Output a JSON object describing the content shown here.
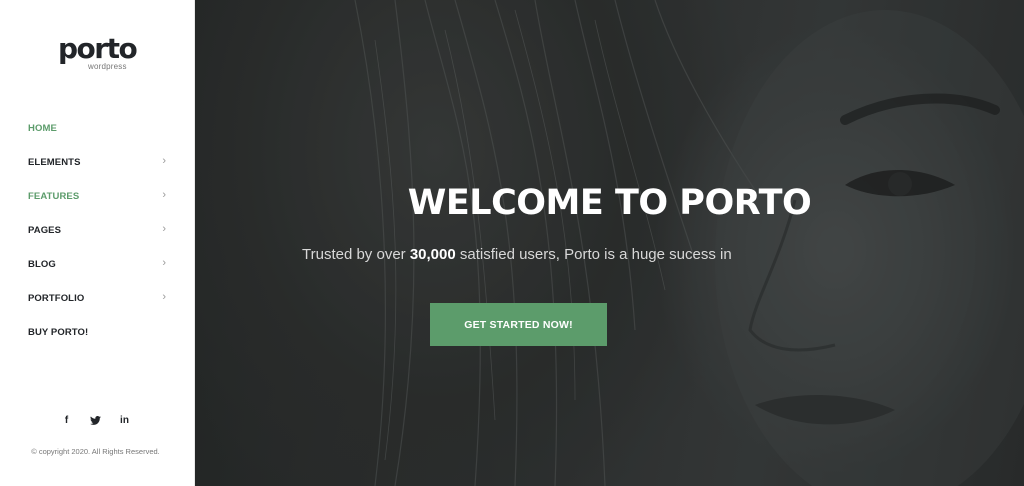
{
  "brand": {
    "name": "porto",
    "subtitle": "wordpress"
  },
  "menu": [
    {
      "label": "HOME",
      "has_submenu": false
    },
    {
      "label": "ELEMENTS",
      "has_submenu": true
    },
    {
      "label": "FEATURES",
      "has_submenu": true
    },
    {
      "label": "PAGES",
      "has_submenu": true
    },
    {
      "label": "BLOG",
      "has_submenu": true
    },
    {
      "label": "PORTFOLIO",
      "has_submenu": true
    },
    {
      "label": "BUY PORTO!",
      "has_submenu": false
    }
  ],
  "submenu_indicator": "›",
  "social": [
    {
      "icon": "facebook-icon",
      "glyph": "f"
    },
    {
      "icon": "twitter-icon",
      "glyph": "t"
    },
    {
      "icon": "linkedin-icon",
      "glyph": "in"
    }
  ],
  "copyright": "© copyright 2020. All Rights Reserved.",
  "hero": {
    "title": "WELCOME TO PORTO",
    "subtitle_pre": "Trusted by over ",
    "subtitle_bold": "30,000",
    "subtitle_post": " satisfied users, Porto is a huge sucess in",
    "cta_label": "GET STARTED NOW!"
  },
  "colors": {
    "accent": "#5c9c6b",
    "text_dark": "#222529",
    "hero_dark": "#2c2f2e"
  }
}
